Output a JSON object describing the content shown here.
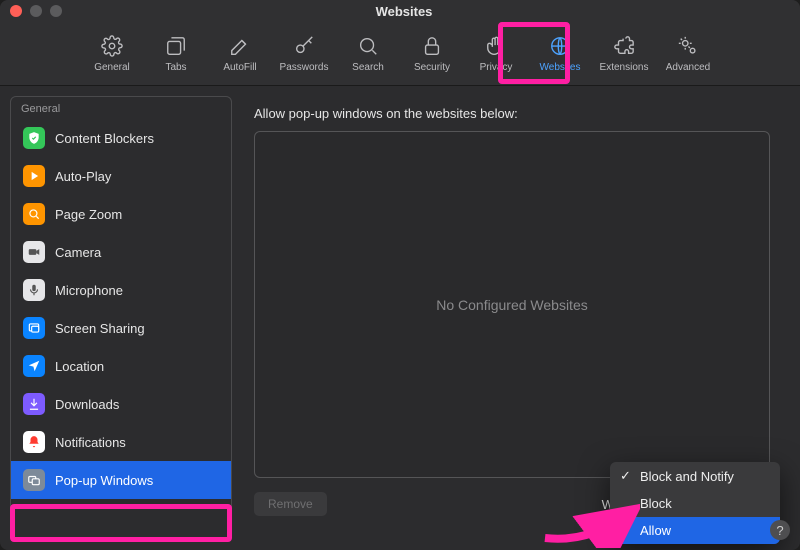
{
  "window": {
    "title": "Websites"
  },
  "toolbar": {
    "items": [
      {
        "id": "general",
        "label": "General"
      },
      {
        "id": "tabs",
        "label": "Tabs"
      },
      {
        "id": "autofill",
        "label": "AutoFill"
      },
      {
        "id": "passwords",
        "label": "Passwords"
      },
      {
        "id": "search",
        "label": "Search"
      },
      {
        "id": "security",
        "label": "Security"
      },
      {
        "id": "privacy",
        "label": "Privacy"
      },
      {
        "id": "websites",
        "label": "Websites",
        "active": true
      },
      {
        "id": "extensions",
        "label": "Extensions"
      },
      {
        "id": "advanced",
        "label": "Advanced"
      }
    ]
  },
  "sidebar": {
    "header": "General",
    "items": [
      {
        "label": "Content Blockers",
        "icon_bg": "#34c759",
        "icon": "shield"
      },
      {
        "label": "Auto-Play",
        "icon_bg": "#ff9500",
        "icon": "play"
      },
      {
        "label": "Page Zoom",
        "icon_bg": "#ff9500",
        "icon": "zoom"
      },
      {
        "label": "Camera",
        "icon_bg": "#e6e6e8",
        "icon": "camera"
      },
      {
        "label": "Microphone",
        "icon_bg": "#e6e6e8",
        "icon": "mic"
      },
      {
        "label": "Screen Sharing",
        "icon_bg": "#0a84ff",
        "icon": "screen"
      },
      {
        "label": "Location",
        "icon_bg": "#0a84ff",
        "icon": "location"
      },
      {
        "label": "Downloads",
        "icon_bg": "#7d5bff",
        "icon": "download"
      },
      {
        "label": "Notifications",
        "icon_bg": "#ffffff",
        "icon": "bell"
      },
      {
        "label": "Pop-up Windows",
        "icon_bg": "#7d8a99",
        "icon": "windows",
        "selected": true
      }
    ]
  },
  "main": {
    "heading": "Allow pop-up windows on the websites below:",
    "empty_text": "No Configured Websites",
    "remove_label": "Remove",
    "footer_label": "When visiting other websites:"
  },
  "dropdown": {
    "options": [
      {
        "label": "Block and Notify",
        "checked": true
      },
      {
        "label": "Block"
      },
      {
        "label": "Allow",
        "selected": true
      }
    ]
  },
  "help": {
    "label": "?"
  }
}
